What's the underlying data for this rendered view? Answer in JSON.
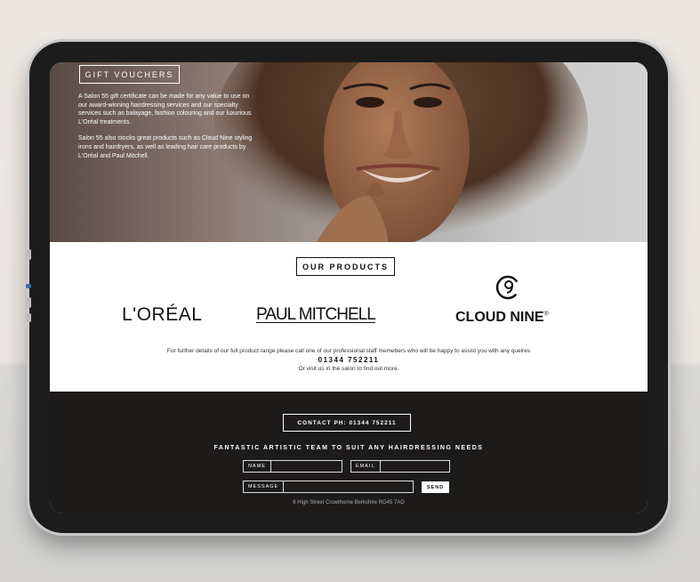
{
  "hero": {
    "gift_title": "GIFT VOUCHERS",
    "paragraph1": "A Salon 55 gift certificate can be made for any value to use on our award-winning hairdressing services and our specialty services such as balayage, fashion colouring and our luxurious L'Oréal treatments.",
    "paragraph2": "Salon 55 also stocks great products such as Cloud Nine styling irons and hairdryers, as well as leading hair care products by L'Oréal and Paul Mitchell."
  },
  "products": {
    "title": "OUR PRODUCTS",
    "logos": {
      "loreal": "L'ORÉAL",
      "paul_mitchell": "PAUL MITCHELL",
      "cloud_nine": "CLOUD NINE",
      "cloud_nine_mark": "®"
    },
    "detail": "For further details of our full product range please call one of our professional staff memebers who will be happy to assist you with any queires",
    "phone": "01344 752211",
    "visit": "Or visit us in the salon to find out more."
  },
  "footer": {
    "contact": "CONTACT PH: 01344 752211",
    "tagline": "FANTASTIC ARTISTIC TEAM TO SUIT ANY HAIRDRESSING NEEDS",
    "name_label": "NAME",
    "email_label": "EMAIL",
    "message_label": "MESSAGE",
    "send_label": "SEND",
    "address": "6 High Street Crowthorne Berkshire RG45 7AD"
  },
  "colors": {
    "footer_bg": "#1d1b1a",
    "hero_text": "#ffffff",
    "accent": "#111111"
  }
}
